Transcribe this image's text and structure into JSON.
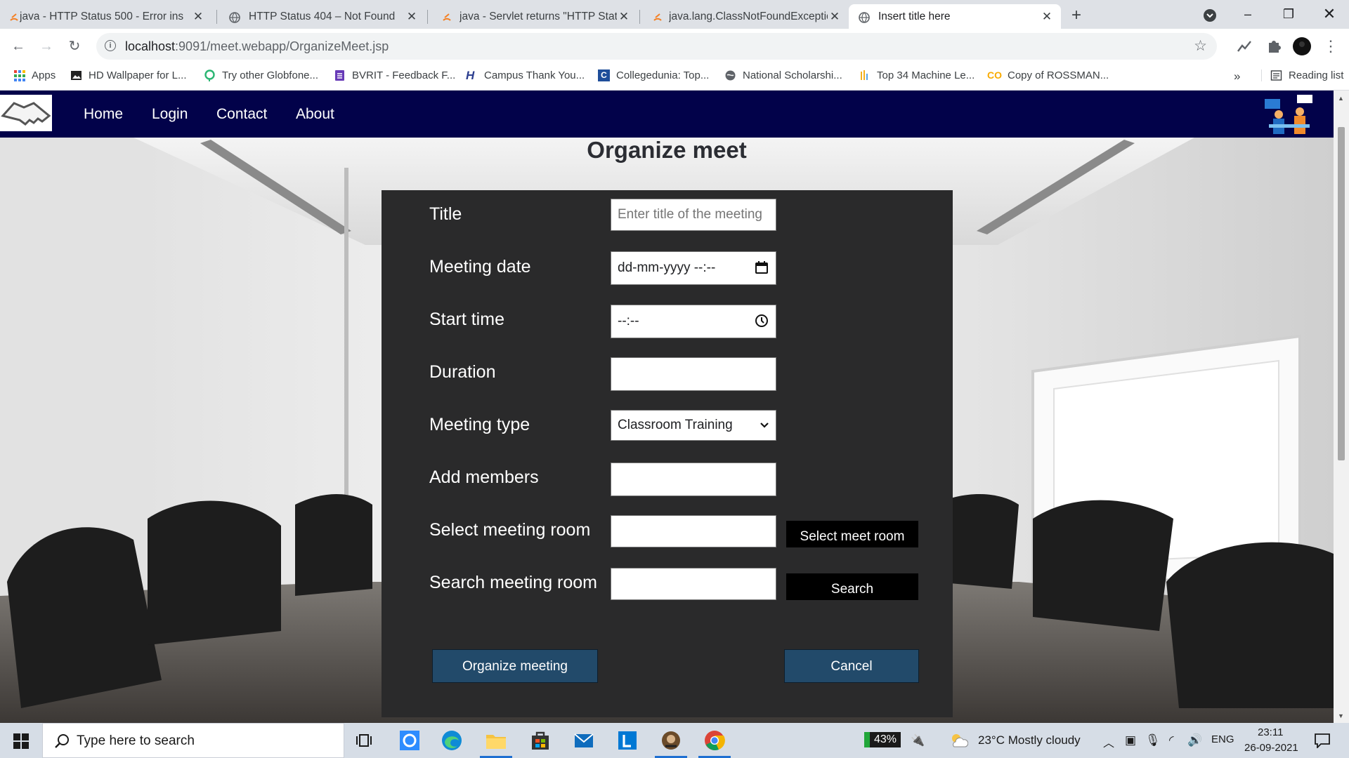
{
  "tabs": [
    {
      "title": "java - HTTP Status 500 - Error ins",
      "close": "✕"
    },
    {
      "title": "HTTP Status 404 – Not Found",
      "close": "✕"
    },
    {
      "title": "java - Servlet returns \"HTTP Statu",
      "close": "✕"
    },
    {
      "title": "java.lang.ClassNotFoundExceptio",
      "close": "✕"
    },
    {
      "title": "Insert title here",
      "close": "✕"
    }
  ],
  "new_tab": "+",
  "address": {
    "host": "localhost",
    "rest": ":9091/meet.webapp/OrganizeMeet.jsp"
  },
  "bookmarks": [
    "Apps",
    "HD Wallpaper for L...",
    "Try other Globfone...",
    "BVRIT - Feedback F...",
    "Campus Thank You...",
    "Collegedunia: Top...",
    "National Scholarshi...",
    "Top 34 Machine Le...",
    "Copy of ROSSMAN..."
  ],
  "bookmarks_more": "»",
  "reading_list": "Reading list",
  "nav": {
    "home": "Home",
    "login": "Login",
    "contact": "Contact",
    "about": "About"
  },
  "page_title": "Organize meet",
  "form": {
    "title_label": "Title",
    "title_placeholder": "Enter title of the meeting",
    "date_label": "Meeting date",
    "date_value": "dd-mm-yyyy --:--",
    "start_label": "Start time",
    "start_value": "--:--",
    "duration_label": "Duration",
    "type_label": "Meeting type",
    "type_value": "Classroom Training",
    "members_label": "Add members",
    "select_room_label": "Select meeting room",
    "select_room_button": "Select meet room",
    "search_room_label": "Search meeting room",
    "search_button": "Search",
    "organize_button": "Organize meeting",
    "cancel_button": "Cancel"
  },
  "taskbar": {
    "search_placeholder": "Type here to search",
    "battery": "43%",
    "weather": "23°C  Mostly cloudy",
    "lang": "ENG",
    "time": "23:11",
    "date": "26-09-2021"
  }
}
